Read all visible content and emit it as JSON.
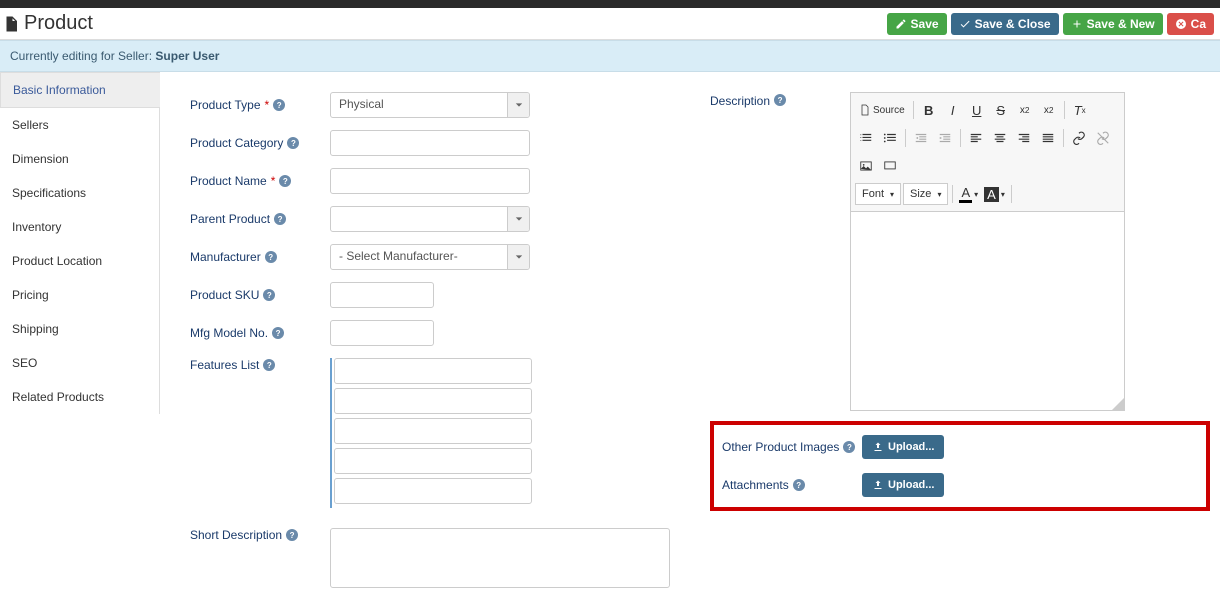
{
  "header": {
    "title": "Product",
    "buttons": {
      "save": "Save",
      "save_close": "Save & Close",
      "save_new": "Save & New",
      "cancel": "Ca"
    }
  },
  "notice": {
    "prefix": "Currently editing for Seller: ",
    "seller": "Super User"
  },
  "sidebar": {
    "items": [
      "Basic Information",
      "Sellers",
      "Dimension",
      "Specifications",
      "Inventory",
      "Product Location",
      "Pricing",
      "Shipping",
      "SEO",
      "Related Products"
    ],
    "active_index": 0
  },
  "form": {
    "product_type": {
      "label": "Product Type",
      "value": "Physical"
    },
    "product_category": {
      "label": "Product Category",
      "value": ""
    },
    "product_name": {
      "label": "Product Name",
      "value": ""
    },
    "parent_product": {
      "label": "Parent Product",
      "value": ""
    },
    "manufacturer": {
      "label": "Manufacturer",
      "value": "- Select Manufacturer-"
    },
    "product_sku": {
      "label": "Product SKU",
      "value": ""
    },
    "mfg_model": {
      "label": "Mfg Model No.",
      "value": ""
    },
    "features": {
      "label": "Features List",
      "values": [
        "",
        "",
        "",
        "",
        ""
      ]
    },
    "short_desc": {
      "label": "Short Description",
      "value": ""
    }
  },
  "right": {
    "description_label": "Description",
    "editor": {
      "source": "Source",
      "font_label": "Font",
      "size_label": "Size"
    },
    "other_images": {
      "label": "Other Product Images",
      "button": "Upload..."
    },
    "attachments": {
      "label": "Attachments",
      "button": "Upload..."
    }
  }
}
